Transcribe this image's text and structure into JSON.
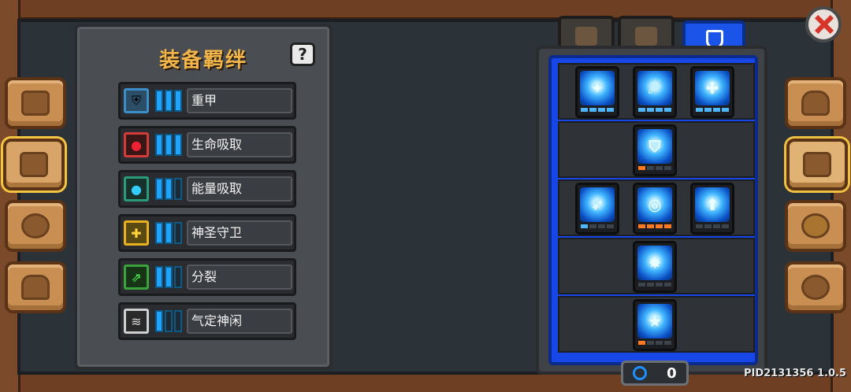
{
  "bond_panel": {
    "title": "装备羁绊",
    "help_label": "?",
    "bonds": [
      {
        "name": "重甲",
        "icon": "heavy-armor-icon",
        "color": "#3b8ec7",
        "level": 3,
        "max": 3
      },
      {
        "name": "生命吸取",
        "icon": "life-steal-icon",
        "color": "#d43c3c",
        "level": 3,
        "max": 3
      },
      {
        "name": "能量吸取",
        "icon": "energy-steal-icon",
        "color": "#2a9c7a",
        "level": 2,
        "max": 3
      },
      {
        "name": "神圣守卫",
        "icon": "holy-guard-icon",
        "color": "#e8b21e",
        "level": 2,
        "max": 3
      },
      {
        "name": "分裂",
        "icon": "split-icon",
        "color": "#3ca33c",
        "level": 2,
        "max": 3
      },
      {
        "name": "气定神闲",
        "icon": "calm-icon",
        "color": "#cfcfcf",
        "level": 1,
        "max": 3
      }
    ]
  },
  "tabs": {
    "items": [
      {
        "icon": "sword-tab-icon",
        "active": false
      },
      {
        "icon": "crown-tab-icon",
        "active": false
      },
      {
        "icon": "shield-tab-icon",
        "active": true
      }
    ]
  },
  "talents": {
    "counter_value": "0",
    "counter_icon": "gem-icon"
  },
  "close_icon": "close-icon",
  "version": "PID2131356 1.0.5",
  "left_side": [
    {
      "icon": "book-icon",
      "selected": false
    },
    {
      "icon": "map-icon",
      "selected": true
    },
    {
      "icon": "pet-icon",
      "selected": false
    },
    {
      "icon": "helmet-icon",
      "selected": false
    }
  ],
  "right_side": [
    {
      "icon": "hero-icon",
      "selected": false
    },
    {
      "icon": "weapon-upgrade-icon",
      "selected": true
    },
    {
      "icon": "talent-star-icon",
      "selected": false
    },
    {
      "icon": "settings-gear-icon",
      "selected": false
    }
  ]
}
